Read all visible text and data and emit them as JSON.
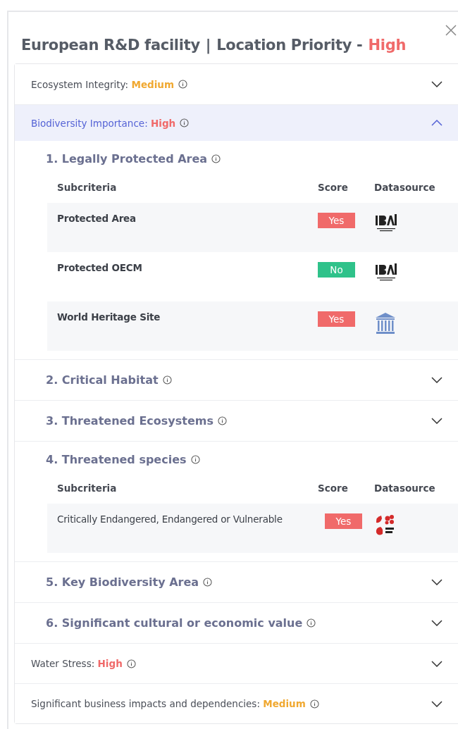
{
  "title": {
    "name": "European R&D facility",
    "separator": "|",
    "label": "Location Priority -",
    "priority": "High",
    "color": "#f06a6a"
  },
  "sections": [
    {
      "label": "Ecosystem Integrity:",
      "rating": "Medium",
      "color": "#f0a830",
      "expanded": false
    },
    {
      "label": "Biodiversity Importance:",
      "rating": "High",
      "color": "#f06a6a",
      "expanded": true,
      "criteria": [
        {
          "title": "1. Legally Protected Area",
          "expanded": true,
          "columns": [
            "Subcriteria",
            "Score",
            "Datasource"
          ],
          "rows": [
            {
              "subcriterion": "Protected Area",
              "score": "Yes",
              "color": "#f06a6a",
              "datasource": {
                "kind": "ibat"
              }
            },
            {
              "subcriterion": "Protected OECM",
              "score": "No",
              "color": "#2fc28a",
              "datasource": {
                "kind": "ibat"
              }
            },
            {
              "subcriterion": "World Heritage Site",
              "score": "Yes",
              "color": "#f06a6a",
              "datasource": {
                "kind": "unesco"
              }
            }
          ]
        },
        {
          "title": "2. Critical Habitat",
          "expanded": false
        },
        {
          "title": "3. Threatened Ecosystems",
          "expanded": false
        },
        {
          "title": "4. Threatened species",
          "expanded": true,
          "columns": [
            "Subcriteria",
            "Score",
            "Datasource"
          ],
          "rows": [
            {
              "subcriterion": "Critically Endangered, Endangered or Vulnerable",
              "score": "Yes",
              "color": "#f06a6a",
              "datasource": {
                "kind": "redlist"
              }
            }
          ]
        },
        {
          "title": "5. Key Biodiversity Area",
          "expanded": false
        },
        {
          "title": "6. Significant cultural or economic value",
          "expanded": false
        }
      ]
    },
    {
      "label": "Water Stress:",
      "rating": "High",
      "color": "#f06a6a",
      "expanded": false
    },
    {
      "label": "Significant business impacts and dependencies:",
      "rating": "Medium",
      "color": "#f0a830",
      "expanded": false
    }
  ]
}
